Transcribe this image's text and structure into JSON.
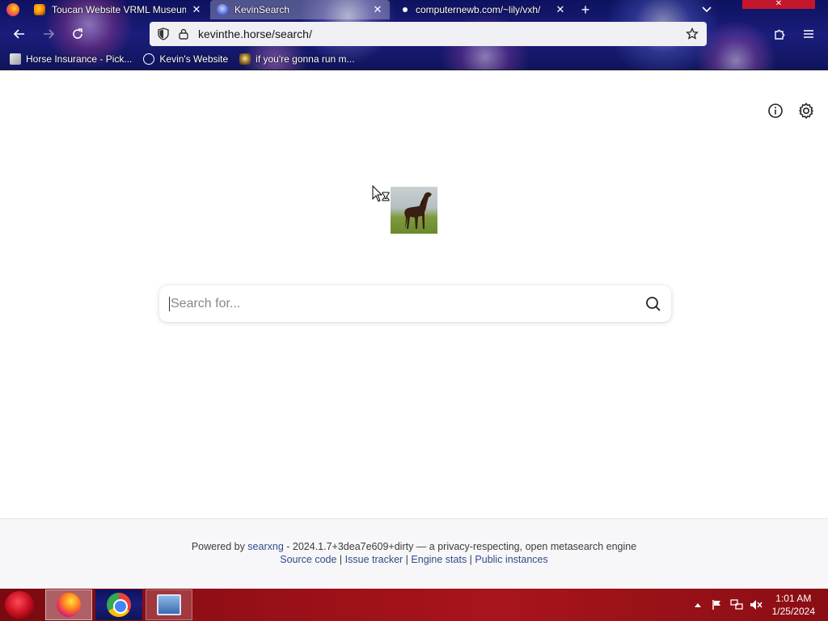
{
  "browser": {
    "tabs": [
      {
        "label": "Toucan Website VRML Museum",
        "active": false
      },
      {
        "label": "KevinSearch",
        "active": true
      },
      {
        "label": "computernewb.com/~lily/vxh/",
        "active": false
      }
    ],
    "url": "kevinthe.horse/search/",
    "bookmarks": [
      {
        "label": "Horse Insurance - Pick..."
      },
      {
        "label": "Kevin's Website"
      },
      {
        "label": "if you're gonna run m..."
      }
    ]
  },
  "search": {
    "placeholder": "Search for..."
  },
  "footer": {
    "powered_prefix": "Powered by ",
    "searxng": "searxng",
    "version_text": " - 2024.1.7+3dea7e609+dirty — a privacy-respecting, open metasearch engine",
    "links": [
      "Source code",
      "Issue tracker",
      "Engine stats",
      "Public instances"
    ],
    "separator": " | "
  },
  "taskbar": {
    "time": "1:01 AM",
    "date": "1/25/2024"
  }
}
